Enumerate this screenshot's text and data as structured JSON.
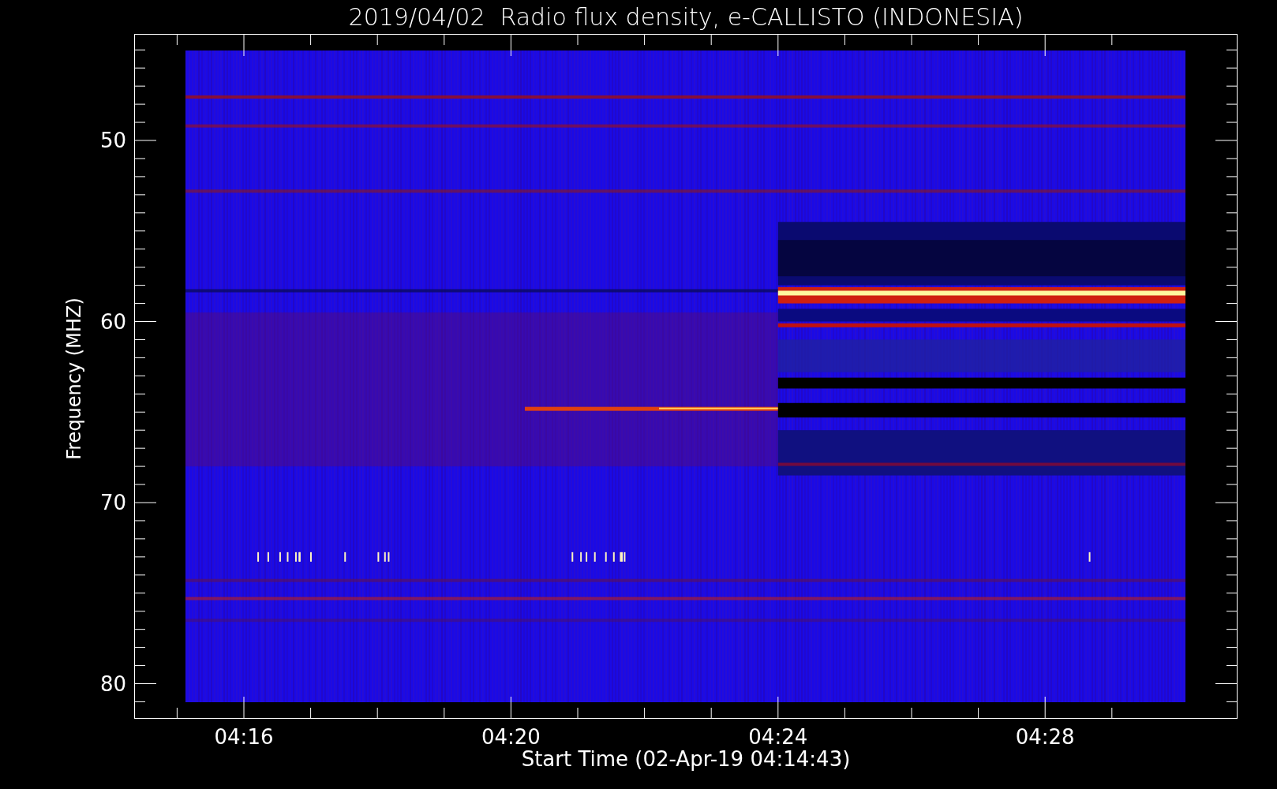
{
  "title": "2019/04/02  Radio flux density, e-CALLISTO (INDONESIA)",
  "y_axis": {
    "label": "Frequency (MHZ)",
    "ticks": [
      "50",
      "60",
      "70",
      "80"
    ]
  },
  "x_axis": {
    "label": "Start Time (02-Apr-19 04:14:43)",
    "ticks": [
      "04:16",
      "04:20",
      "04:24",
      "04:28"
    ]
  }
}
